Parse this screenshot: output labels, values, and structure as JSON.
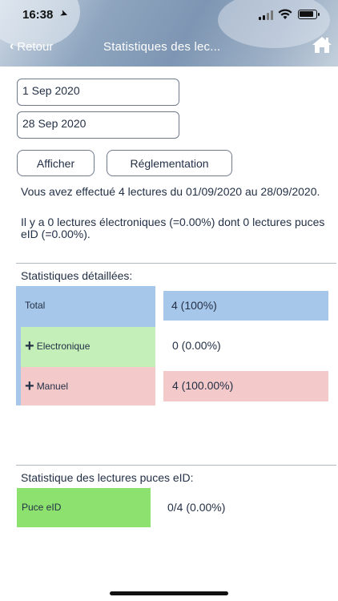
{
  "status_bar": {
    "time": "16:38",
    "location_icon": "➤"
  },
  "nav": {
    "back_label": "Retour",
    "back_icon": "‹",
    "title": "Statistiques des lec..."
  },
  "dates": {
    "start": "1 Sep 2020",
    "end": "28 Sep 2020"
  },
  "buttons": {
    "show": "Afficher",
    "regulation": "Réglementation"
  },
  "summary": {
    "line1": "Vous avez effectué 4 lectures du 01/09/2020 au 28/09/2020.",
    "line2": "Il y a 0 lectures électroniques (=0.00%) dont 0 lectures puces eID (=0.00%)."
  },
  "detailed": {
    "title": "Statistiques détaillées:",
    "total_label": "Total",
    "total_value": "4 (100%)",
    "electronic_label": "Electronique",
    "electronic_value": "0 (0.00%)",
    "manual_label": "Manuel",
    "manual_value": "4 (100.00%)",
    "expand_icon": "+"
  },
  "eid": {
    "title": "Statistique des lectures puces eID:",
    "label": "Puce eID",
    "value": "0/4 (0.00%)"
  },
  "colors": {
    "total": "#a7c7ea",
    "electronic": "#c5efb8",
    "manual": "#f4c9c9",
    "eid": "#8de26f"
  }
}
